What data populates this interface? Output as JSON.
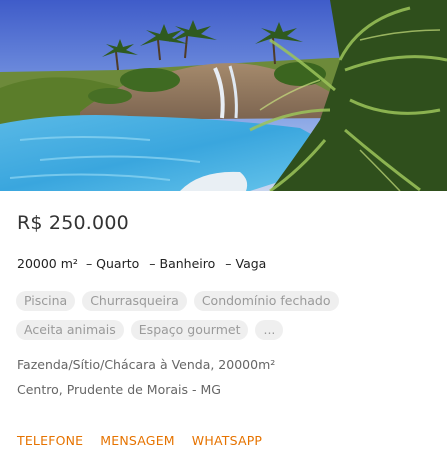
{
  "listing": {
    "image_alt": "Piscina com palmeiras e cascata",
    "price": "R$ 250.000",
    "specs": {
      "area": "20000 m²",
      "bedrooms": "– Quarto",
      "bathrooms": "– Banheiro",
      "parking": "– Vaga"
    },
    "amenities": [
      "Piscina",
      "Churrasqueira",
      "Condomínio fechado",
      "Aceita animais",
      "Espaço gourmet",
      "..."
    ],
    "property_type": "Fazenda/Sítio/Chácara à Venda, 20000m²",
    "location": "Centro, Prudente de Morais - MG"
  },
  "actions": {
    "phone": "TELEFONE",
    "message": "MENSAGEM",
    "whatsapp": "WHATSAPP"
  },
  "colors": {
    "accent": "#e67300",
    "tag_bg": "#efefef",
    "tag_text": "#9a9a9a"
  }
}
